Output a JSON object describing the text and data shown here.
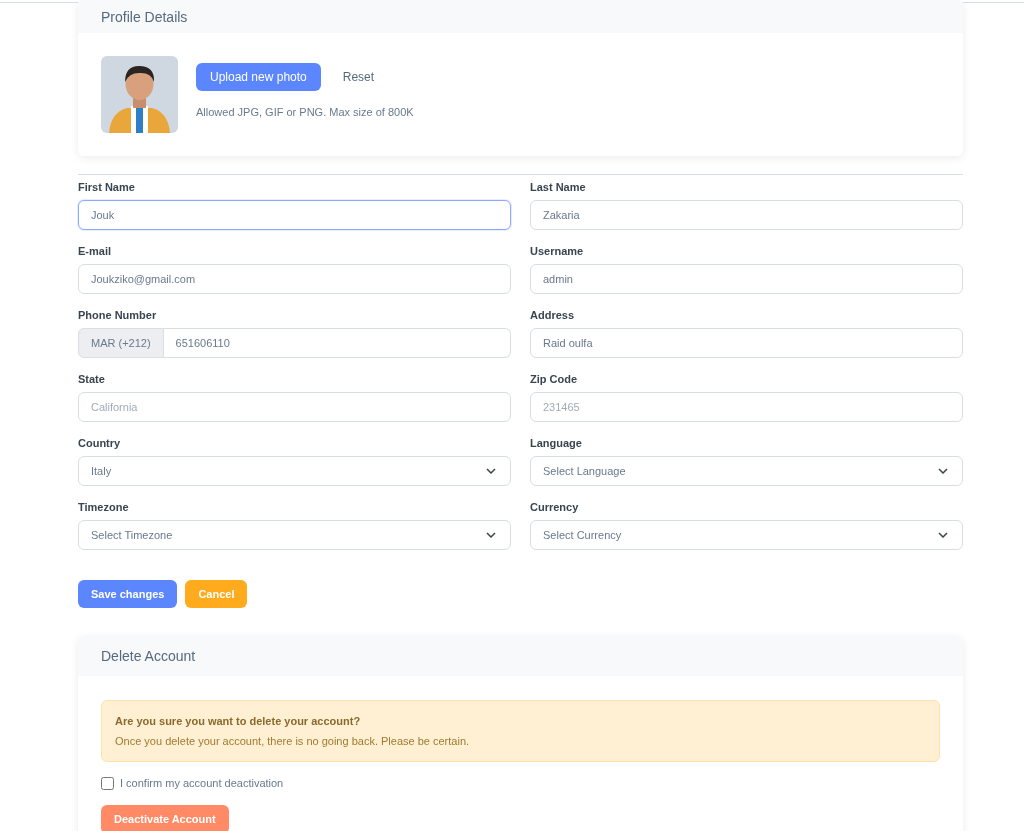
{
  "profile_card": {
    "title": "Profile Details",
    "upload_button": "Upload new photo",
    "reset_button": "Reset",
    "hint": "Allowed JPG, GIF or PNG. Max size of 800K"
  },
  "fields": [
    {
      "kind": "text",
      "label": "First Name",
      "value": "Jouk",
      "focused": true
    },
    {
      "kind": "text",
      "label": "Last Name",
      "value": "Zakaria",
      "focused": false
    },
    {
      "kind": "text",
      "label": "E-mail",
      "value": "Joukziko@gmail.com",
      "focused": false
    },
    {
      "kind": "text",
      "label": "Username",
      "value": "admin",
      "focused": false
    },
    {
      "kind": "phone",
      "label": "Phone Number",
      "prefix": "MAR (+212)",
      "value": "651606110",
      "focused": false
    },
    {
      "kind": "text",
      "label": "Address",
      "value": "Raid oulfa",
      "focused": false
    },
    {
      "kind": "text",
      "label": "State",
      "placeholder": "California",
      "focused": false
    },
    {
      "kind": "text",
      "label": "Zip Code",
      "placeholder": "231465",
      "focused": false
    },
    {
      "kind": "select",
      "label": "Country",
      "value": "Italy",
      "focused": false
    },
    {
      "kind": "select",
      "label": "Language",
      "value": "Select Language",
      "focused": false
    },
    {
      "kind": "select",
      "label": "Timezone",
      "value": "Select Timezone",
      "focused": false
    },
    {
      "kind": "select",
      "label": "Currency",
      "value": "Select Currency",
      "focused": false
    }
  ],
  "form_buttons": [
    {
      "kind": "primary",
      "label": "Save changes"
    },
    {
      "kind": "warning",
      "label": "Cancel"
    }
  ],
  "delete_card": {
    "title": "Delete Account",
    "alert_title": "Are you sure you want to delete your account?",
    "alert_text": "Once you delete your account, there is no going back. Please be certain.",
    "confirm": {
      "label": "I confirm my account deactivation",
      "checked": false
    },
    "button": "Deactivate Account"
  }
}
